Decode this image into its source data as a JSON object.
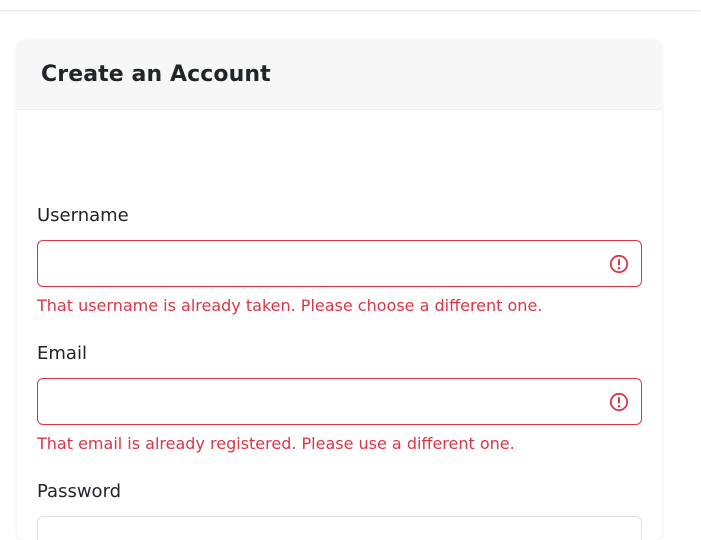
{
  "form": {
    "title": "Create an Account",
    "fields": {
      "username": {
        "label": "Username",
        "value": "",
        "placeholder": "",
        "error": "That username is already taken. Please choose a different one.",
        "invalid": true
      },
      "email": {
        "label": "Email",
        "value": "",
        "placeholder": "",
        "error": "That email is already registered. Please use a different one.",
        "invalid": true
      },
      "password": {
        "label": "Password",
        "value": "",
        "placeholder": "",
        "invalid": false
      }
    }
  },
  "icons": {
    "error": "exclamation-circle"
  },
  "colors": {
    "error": "#dc3545",
    "header_bg": "#f7f7f7",
    "input_border": "#dee2e6"
  }
}
